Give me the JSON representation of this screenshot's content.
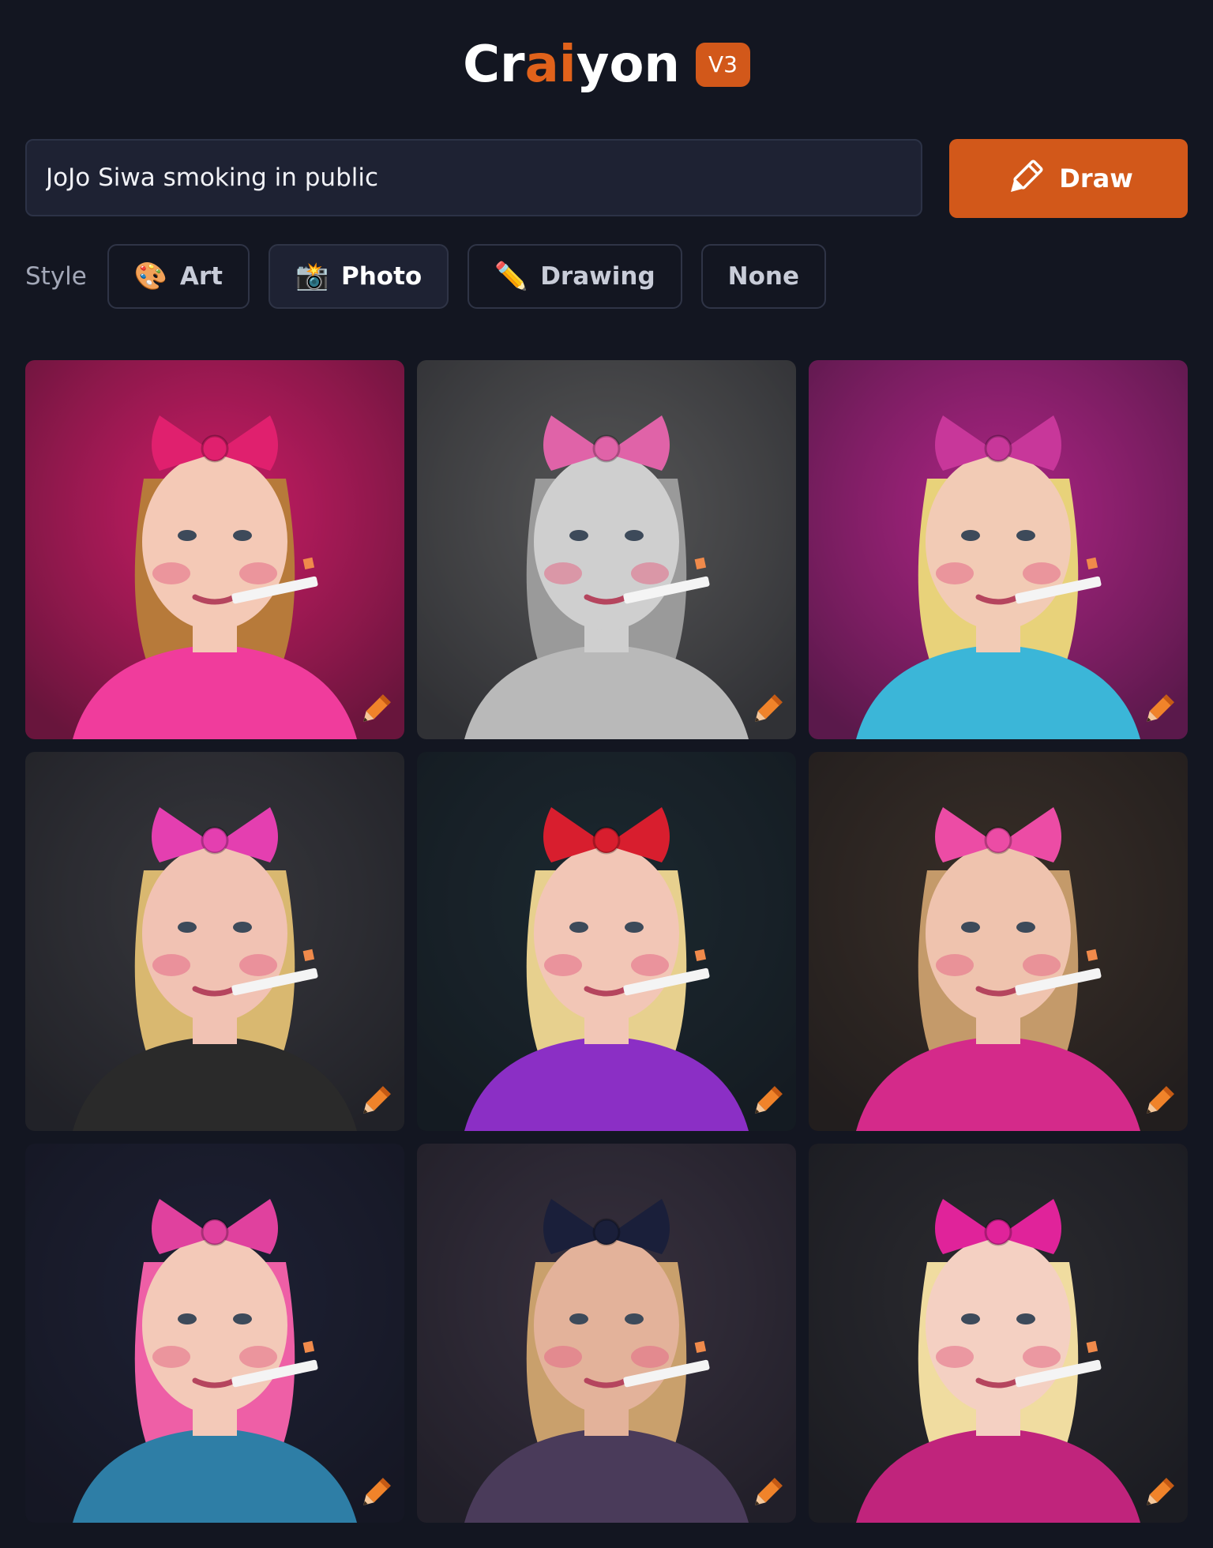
{
  "header": {
    "logo_part1": "Cr",
    "logo_part2": "ai",
    "logo_part3": "yon",
    "version": "V3"
  },
  "prompt": {
    "value": "JoJo Siwa smoking in public",
    "draw_label": "Draw"
  },
  "style": {
    "label": "Style",
    "options": [
      {
        "label": "Art",
        "emoji": "🎨",
        "icon": "palette-icon",
        "selected": false
      },
      {
        "label": "Photo",
        "emoji": "📸",
        "icon": "camera-flash-icon",
        "selected": true
      },
      {
        "label": "Drawing",
        "emoji": "✏️",
        "icon": "pencil-icon",
        "selected": false
      },
      {
        "label": "None",
        "emoji": "",
        "icon": "",
        "selected": false
      }
    ]
  },
  "colors": {
    "background": "#131621",
    "accent": "#d2581a",
    "input_bg": "#1e2233",
    "border": "#2f3446"
  },
  "results": {
    "count": 9,
    "tiles": [
      {
        "bg": "#d81d6a",
        "skin": "#f4c9b6",
        "hair": "#b77a3a",
        "bow": "#e0206e",
        "cloth": "#f03c9c"
      },
      {
        "bg": "#5a5a5a",
        "skin": "#cfcfcf",
        "hair": "#9a9a9a",
        "bow": "#e063a8",
        "cloth": "#b9b9b9"
      },
      {
        "bg": "#b8268c",
        "skin": "#f2cbb5",
        "hair": "#e8d27a",
        "bow": "#c8379a",
        "cloth": "#3bb6d8"
      },
      {
        "bg": "#3a3a3f",
        "skin": "#f1c2b3",
        "hair": "#d9b870",
        "bow": "#e43fb0",
        "cloth": "#2a2a2a"
      },
      {
        "bg": "#1c2a30",
        "skin": "#f2c6b6",
        "hair": "#e7d08e",
        "bow": "#d81e2e",
        "cloth": "#8b2fc5"
      },
      {
        "bg": "#3b3028",
        "skin": "#efc3ae",
        "hair": "#c49a6a",
        "bow": "#ec4ca5",
        "cloth": "#d42a8a"
      },
      {
        "bg": "#1e2235",
        "skin": "#f3c9b8",
        "hair": "#ee5fa6",
        "bow": "#e0419e",
        "cloth": "#2e7ea6"
      },
      {
        "bg": "#3a3240",
        "skin": "#e3b29a",
        "hair": "#c9a06c",
        "bow": "#1a1f3a",
        "cloth": "#4a3b5a"
      },
      {
        "bg": "#2d2c30",
        "skin": "#f4d0c2",
        "hair": "#f0dca0",
        "bow": "#e0239a",
        "cloth": "#c0247c"
      }
    ]
  }
}
